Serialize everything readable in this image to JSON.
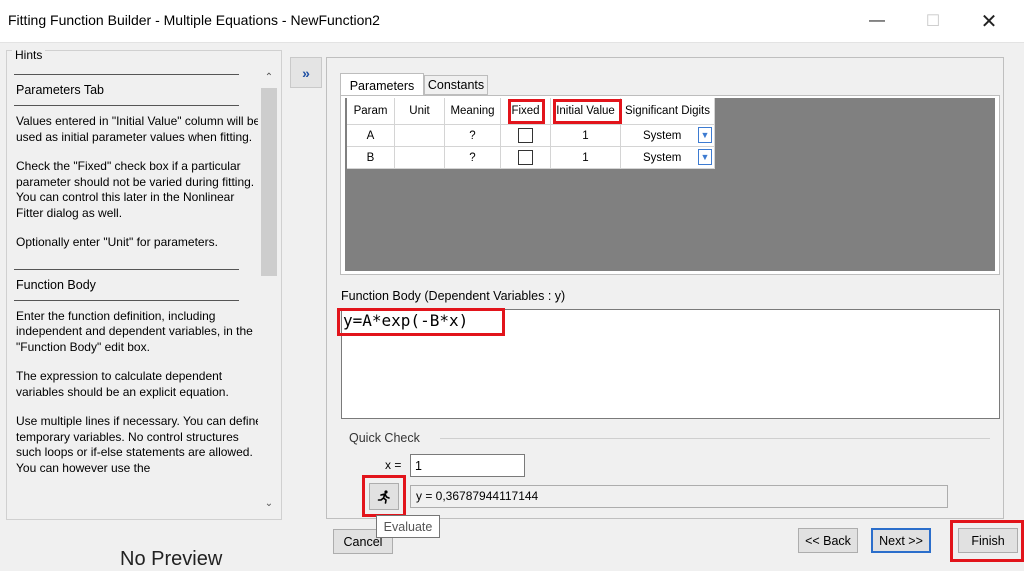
{
  "window": {
    "title": "Fitting Function Builder - Multiple Equations - NewFunction2",
    "minimize_icon": "minimize-icon",
    "maximize_icon": "maximize-icon",
    "close_icon": "close-icon"
  },
  "hints": {
    "group_label": "Hints",
    "sections": [
      {
        "heading": "Parameters Tab",
        "paragraphs": [
          "Values entered in \"Initial Value\" column will be used as initial parameter values when fitting.",
          "Check the \"Fixed\" check box if a particular parameter should not be varied during fitting. You can control this later in the Nonlinear Fitter dialog as well.",
          "Optionally enter \"Unit\" for parameters."
        ]
      },
      {
        "heading": "Function Body",
        "paragraphs": [
          "Enter the function definition, including independent and dependent variables, in the \"Function Body\" edit box.",
          "The expression to calculate dependent variables should be an explicit equation.",
          "Use multiple lines if necessary. You can define temporary variables. No control structures such loops or if-else statements are allowed. You can however use the"
        ]
      }
    ]
  },
  "expand_label": "»",
  "tabs": {
    "parameters": "Parameters",
    "constants": "Constants"
  },
  "param_table": {
    "headers": [
      "Param",
      "Unit",
      "Meaning",
      "Fixed",
      "Initial Value",
      "Significant Digits"
    ],
    "rows": [
      {
        "param": "A",
        "unit": "",
        "meaning": "?",
        "fixed": false,
        "initial_value": "1",
        "sig_digits": "System"
      },
      {
        "param": "B",
        "unit": "",
        "meaning": "?",
        "fixed": false,
        "initial_value": "1",
        "sig_digits": "System"
      }
    ]
  },
  "function_body": {
    "label": "Function Body (Dependent Variables : y)",
    "text": "y=A*exp(-B*x)"
  },
  "quick_check": {
    "label": "Quick Check",
    "x_label": "x =",
    "x_value": "1",
    "result": "y = 0,36787944117144",
    "evaluate_tooltip": "Evaluate"
  },
  "buttons": {
    "cancel": "Cancel",
    "back": "<< Back",
    "next": "Next >>",
    "finish": "Finish"
  },
  "background_text": "No Preview",
  "highlight_color": "#e2141b"
}
